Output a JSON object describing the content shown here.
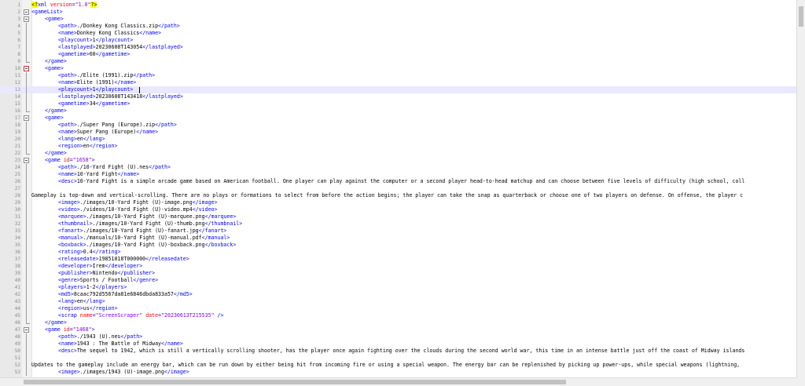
{
  "editor": {
    "current_line": 13,
    "lines": [
      {
        "n": "1",
        "indent": 0,
        "segs": [
          [
            "pi",
            "<?"
          ],
          [
            "t",
            "xml "
          ],
          [
            "an",
            "version"
          ],
          [
            "t",
            "="
          ],
          [
            "av",
            "\"1.0\""
          ],
          [
            "pi",
            "?>"
          ]
        ]
      },
      {
        "n": "2",
        "indent": 0,
        "segs": [
          [
            "t",
            "<gameList>"
          ]
        ]
      },
      {
        "n": "3",
        "indent": 1,
        "segs": [
          [
            "t",
            "<game>"
          ]
        ]
      },
      {
        "n": "4",
        "indent": 2,
        "segs": [
          [
            "t",
            "<path>"
          ],
          [
            "tx",
            "./Donkey Kong Classics.zip"
          ],
          [
            "t",
            "</path>"
          ]
        ]
      },
      {
        "n": "5",
        "indent": 2,
        "segs": [
          [
            "t",
            "<name>"
          ],
          [
            "tx",
            "Donkey Kong Classics"
          ],
          [
            "t",
            "</name>"
          ]
        ]
      },
      {
        "n": "6",
        "indent": 2,
        "segs": [
          [
            "t",
            "<playcount>"
          ],
          [
            "tx",
            "1"
          ],
          [
            "t",
            "</playcount>"
          ]
        ]
      },
      {
        "n": "7",
        "indent": 2,
        "segs": [
          [
            "t",
            "<lastplayed>"
          ],
          [
            "tx",
            "20230608T143054"
          ],
          [
            "t",
            "</lastplayed>"
          ]
        ]
      },
      {
        "n": "8",
        "indent": 2,
        "segs": [
          [
            "t",
            "<gametime>"
          ],
          [
            "tx",
            "60"
          ],
          [
            "t",
            "</gametime>"
          ]
        ]
      },
      {
        "n": "9",
        "indent": 1,
        "segs": [
          [
            "t",
            "</game>"
          ]
        ]
      },
      {
        "n": "10",
        "indent": 1,
        "segs": [
          [
            "t",
            "<game>"
          ]
        ]
      },
      {
        "n": "11",
        "indent": 2,
        "segs": [
          [
            "t",
            "<path>"
          ],
          [
            "tx",
            "./Elite (1991).zip"
          ],
          [
            "t",
            "</path>"
          ]
        ]
      },
      {
        "n": "12",
        "indent": 2,
        "segs": [
          [
            "t",
            "<name>"
          ],
          [
            "tx",
            "Elite (1991)"
          ],
          [
            "t",
            "</name>"
          ]
        ]
      },
      {
        "n": "13",
        "indent": 2,
        "segs": [
          [
            "t",
            "<playcount>"
          ],
          [
            "tx",
            "1"
          ],
          [
            "t",
            "</playcount>"
          ]
        ]
      },
      {
        "n": "14",
        "indent": 2,
        "segs": [
          [
            "t",
            "<lastplayed>"
          ],
          [
            "tx",
            "20230608T143418"
          ],
          [
            "t",
            "</lastplayed>"
          ]
        ]
      },
      {
        "n": "15",
        "indent": 2,
        "segs": [
          [
            "t",
            "<gametime>"
          ],
          [
            "tx",
            "34"
          ],
          [
            "t",
            "</gametime>"
          ]
        ]
      },
      {
        "n": "16",
        "indent": 1,
        "segs": [
          [
            "t",
            "</game>"
          ]
        ]
      },
      {
        "n": "17",
        "indent": 1,
        "segs": [
          [
            "t",
            "<game>"
          ]
        ]
      },
      {
        "n": "18",
        "indent": 2,
        "segs": [
          [
            "t",
            "<path>"
          ],
          [
            "tx",
            "./Super Pang (Europe).zip"
          ],
          [
            "t",
            "</path>"
          ]
        ]
      },
      {
        "n": "19",
        "indent": 2,
        "segs": [
          [
            "t",
            "<name>"
          ],
          [
            "tx",
            "Super Pang (Europe)"
          ],
          [
            "t",
            "</name>"
          ]
        ]
      },
      {
        "n": "20",
        "indent": 2,
        "segs": [
          [
            "t",
            "<lang>"
          ],
          [
            "tx",
            "en"
          ],
          [
            "t",
            "</lang>"
          ]
        ]
      },
      {
        "n": "21",
        "indent": 2,
        "segs": [
          [
            "t",
            "<region>"
          ],
          [
            "tx",
            "en"
          ],
          [
            "t",
            "</region>"
          ]
        ]
      },
      {
        "n": "22",
        "indent": 1,
        "segs": [
          [
            "t",
            "</game>"
          ]
        ]
      },
      {
        "n": "23",
        "indent": 1,
        "segs": [
          [
            "t",
            "<game "
          ],
          [
            "an",
            "id"
          ],
          [
            "t",
            "="
          ],
          [
            "av",
            "\"1658\""
          ],
          [
            "t",
            ">"
          ]
        ]
      },
      {
        "n": "24",
        "indent": 2,
        "segs": [
          [
            "t",
            "<path>"
          ],
          [
            "tx",
            "./10-Yard Fight (U).nes"
          ],
          [
            "t",
            "</path>"
          ]
        ]
      },
      {
        "n": "25",
        "indent": 2,
        "segs": [
          [
            "t",
            "<name>"
          ],
          [
            "tx",
            "10-Yard Fight"
          ],
          [
            "t",
            "</name>"
          ]
        ]
      },
      {
        "n": "26",
        "indent": 2,
        "segs": [
          [
            "t",
            "<desc>"
          ],
          [
            "tx",
            "10-Yard Fight is a simple arcade game based on American football. One player can play against the computer or a second player head-to-head matchup and can choose between five levels of difficulty (high school, coll"
          ]
        ]
      },
      {
        "n": "27",
        "indent": 0,
        "segs": []
      },
      {
        "n": "28",
        "indent": 0,
        "segs": [
          [
            "tx",
            "Gameplay is top-down and vertical-scrolling. There are no plays or formations to select from before the action begins; the player can take the snap as quarterback or choose one of two players on defense. On offense, the player c"
          ]
        ]
      },
      {
        "n": "29",
        "indent": 2,
        "segs": [
          [
            "t",
            "<image>"
          ],
          [
            "tx",
            "./images/10-Yard Fight (U)-image.png"
          ],
          [
            "t",
            "</image>"
          ]
        ]
      },
      {
        "n": "30",
        "indent": 2,
        "segs": [
          [
            "t",
            "<video>"
          ],
          [
            "tx",
            "./videos/10-Yard Fight (U)-video.mp4"
          ],
          [
            "t",
            "</video>"
          ]
        ]
      },
      {
        "n": "31",
        "indent": 2,
        "segs": [
          [
            "t",
            "<marquee>"
          ],
          [
            "tx",
            "./images/10-Yard Fight (U)-marquee.png"
          ],
          [
            "t",
            "</marquee>"
          ]
        ]
      },
      {
        "n": "32",
        "indent": 2,
        "segs": [
          [
            "t",
            "<thumbnail>"
          ],
          [
            "tx",
            "./images/10-Yard Fight (U)-thumb.png"
          ],
          [
            "t",
            "</thumbnail>"
          ]
        ]
      },
      {
        "n": "33",
        "indent": 2,
        "segs": [
          [
            "t",
            "<fanart>"
          ],
          [
            "tx",
            "./images/10-Yard Fight (U)-fanart.jpg"
          ],
          [
            "t",
            "</fanart>"
          ]
        ]
      },
      {
        "n": "34",
        "indent": 2,
        "segs": [
          [
            "t",
            "<manual>"
          ],
          [
            "tx",
            "./manuals/10-Yard Fight (U)-manual.pdf"
          ],
          [
            "t",
            "</manual>"
          ]
        ]
      },
      {
        "n": "35",
        "indent": 2,
        "segs": [
          [
            "t",
            "<boxback>"
          ],
          [
            "tx",
            "./images/10-Yard Fight (U)-boxback.png"
          ],
          [
            "t",
            "</boxback>"
          ]
        ]
      },
      {
        "n": "36",
        "indent": 2,
        "segs": [
          [
            "t",
            "<rating>"
          ],
          [
            "tx",
            "0.4"
          ],
          [
            "t",
            "</rating>"
          ]
        ]
      },
      {
        "n": "37",
        "indent": 2,
        "segs": [
          [
            "t",
            "<releasedate>"
          ],
          [
            "tx",
            "19851018T000000"
          ],
          [
            "t",
            "</releasedate>"
          ]
        ]
      },
      {
        "n": "38",
        "indent": 2,
        "segs": [
          [
            "t",
            "<developer>"
          ],
          [
            "tx",
            "Irem"
          ],
          [
            "t",
            "</developer>"
          ]
        ]
      },
      {
        "n": "39",
        "indent": 2,
        "segs": [
          [
            "t",
            "<publisher>"
          ],
          [
            "tx",
            "Nintendo"
          ],
          [
            "t",
            "</publisher>"
          ]
        ]
      },
      {
        "n": "40",
        "indent": 2,
        "segs": [
          [
            "t",
            "<genre>"
          ],
          [
            "tx",
            "Sports / Football"
          ],
          [
            "t",
            "</genre>"
          ]
        ]
      },
      {
        "n": "41",
        "indent": 2,
        "segs": [
          [
            "t",
            "<players>"
          ],
          [
            "tx",
            "1-2"
          ],
          [
            "t",
            "</players>"
          ]
        ]
      },
      {
        "n": "42",
        "indent": 2,
        "segs": [
          [
            "t",
            "<md5>"
          ],
          [
            "tx",
            "8caac792d5567da81e6846dbda833a57"
          ],
          [
            "t",
            "</md5>"
          ]
        ]
      },
      {
        "n": "43",
        "indent": 2,
        "segs": [
          [
            "t",
            "<lang>"
          ],
          [
            "tx",
            "en"
          ],
          [
            "t",
            "</lang>"
          ]
        ]
      },
      {
        "n": "44",
        "indent": 2,
        "segs": [
          [
            "t",
            "<region>"
          ],
          [
            "tx",
            "us"
          ],
          [
            "t",
            "</region>"
          ]
        ]
      },
      {
        "n": "45",
        "indent": 2,
        "segs": [
          [
            "t",
            "<scrap "
          ],
          [
            "an",
            "name"
          ],
          [
            "t",
            "="
          ],
          [
            "av",
            "\"ScreenScraper\""
          ],
          [
            "t",
            " "
          ],
          [
            "an",
            "date"
          ],
          [
            "t",
            "="
          ],
          [
            "av",
            "\"20230613T215535\""
          ],
          [
            "t",
            " />"
          ]
        ]
      },
      {
        "n": "46",
        "indent": 1,
        "segs": [
          [
            "t",
            "</game>"
          ]
        ]
      },
      {
        "n": "47",
        "indent": 1,
        "segs": [
          [
            "t",
            "<game "
          ],
          [
            "an",
            "id"
          ],
          [
            "t",
            "="
          ],
          [
            "av",
            "\"1468\""
          ],
          [
            "t",
            ">"
          ]
        ]
      },
      {
        "n": "48",
        "indent": 2,
        "segs": [
          [
            "t",
            "<path>"
          ],
          [
            "tx",
            "./1943 (U).nes"
          ],
          [
            "t",
            "</path>"
          ]
        ]
      },
      {
        "n": "49",
        "indent": 2,
        "segs": [
          [
            "t",
            "<name>"
          ],
          [
            "tx",
            "1943 : The Battle of Midway"
          ],
          [
            "t",
            "</name>"
          ]
        ]
      },
      {
        "n": "50",
        "indent": 2,
        "segs": [
          [
            "t",
            "<desc>"
          ],
          [
            "tx",
            "The sequel to 1942, which is still a vertically scrolling shooter, has the player once again fighting over the clouds during the second world war, this time in an intense battle just off the coast of Midway islands"
          ]
        ]
      },
      {
        "n": "51",
        "indent": 0,
        "segs": []
      },
      {
        "n": "52",
        "indent": 0,
        "segs": [
          [
            "tx",
            "Updates to the gameplay include an energy bar, which can be run down by either being hit from incoming fire or using a special weapon. The energy bar can be replenished by picking up power-ups, while special weapons (lightning,"
          ]
        ]
      },
      {
        "n": "53",
        "indent": 2,
        "segs": [
          [
            "t",
            "<image>"
          ],
          [
            "tx",
            "./images/1943 (U)-image.png"
          ],
          [
            "t",
            "</image>"
          ]
        ]
      }
    ]
  }
}
